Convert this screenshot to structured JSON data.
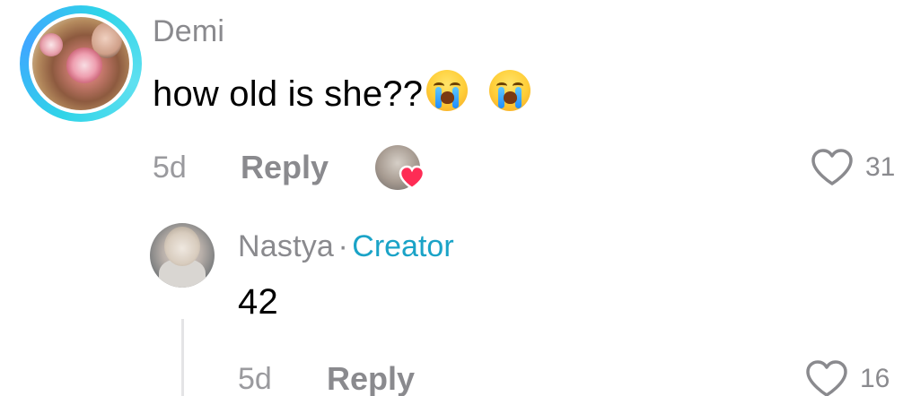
{
  "comment": {
    "username": "Demi",
    "text": "how old is she??",
    "emojis": [
      "loudly-crying-face",
      "loudly-crying-face"
    ],
    "time": "5d",
    "reply_label": "Reply",
    "like_count": "31",
    "creator_liked": true,
    "colors": {
      "ring": "#2fd4e8",
      "username": "#8a8a8e",
      "heart_badge": "#fe2c55"
    }
  },
  "reply": {
    "username": "Nastya",
    "separator": "·",
    "badge": "Creator",
    "text": "42",
    "time": "5d",
    "reply_label": "Reply",
    "like_count": "16",
    "colors": {
      "badge": "#1aa3c7"
    }
  }
}
